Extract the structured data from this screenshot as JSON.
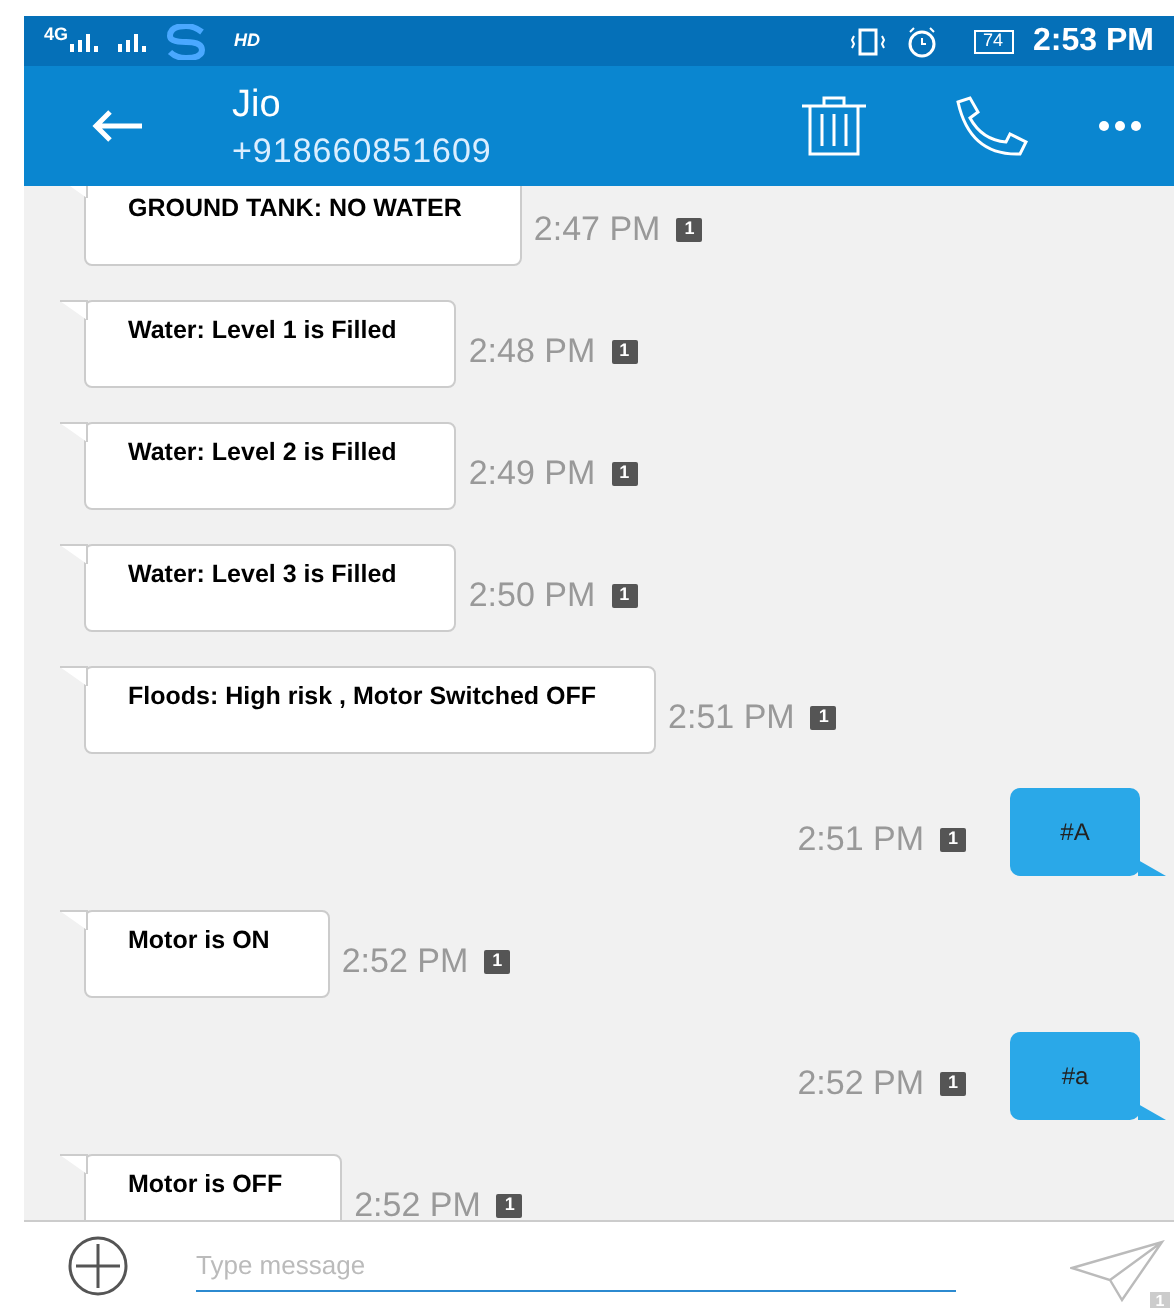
{
  "status_bar": {
    "network": "4G",
    "hd": "HD",
    "battery": "74",
    "time": "2:53 PM"
  },
  "app_bar": {
    "title": "Jio",
    "subtitle": "+918660851609"
  },
  "messages": [
    {
      "kind": "received",
      "text": "GROUND TANK: NO WATER",
      "time": "2:47 PM",
      "sim": "1"
    },
    {
      "kind": "received",
      "text": "Water: Level 1 is Filled",
      "time": "2:48 PM",
      "sim": "1"
    },
    {
      "kind": "received",
      "text": "Water: Level 2 is Filled",
      "time": "2:49 PM",
      "sim": "1"
    },
    {
      "kind": "received",
      "text": "Water: Level 3 is Filled",
      "time": "2:50 PM",
      "sim": "1"
    },
    {
      "kind": "received",
      "text": "Floods: High risk , Motor Switched OFF",
      "time": "2:51 PM",
      "sim": "1"
    },
    {
      "kind": "sent",
      "text": "#A",
      "time": "2:51 PM",
      "sim": "1"
    },
    {
      "kind": "received",
      "text": "Motor is ON",
      "time": "2:52 PM",
      "sim": "1"
    },
    {
      "kind": "sent",
      "text": "#a",
      "time": "2:52 PM",
      "sim": "1"
    },
    {
      "kind": "received",
      "text": "Motor is OFF",
      "time": "2:52 PM",
      "sim": "1"
    }
  ],
  "composer": {
    "placeholder": "Type message",
    "send_sim": "1"
  }
}
